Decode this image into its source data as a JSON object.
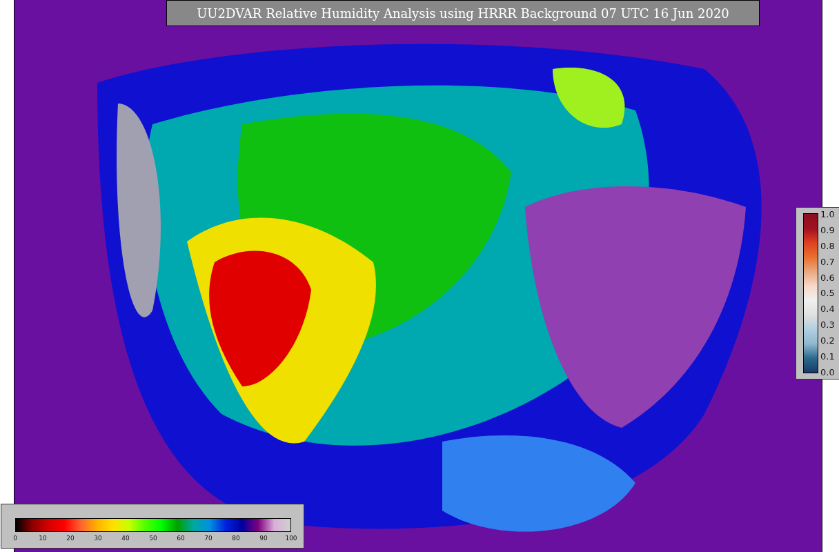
{
  "title": "UU2DVAR Relative Humidity Analysis using HRRR Background 07 UTC 16 Jun 2020",
  "humidity_colorbar": {
    "ticks": [
      "0",
      "10",
      "20",
      "30",
      "40",
      "50",
      "60",
      "70",
      "80",
      "90",
      "100"
    ]
  },
  "ratio_colorbar": {
    "ticks": [
      "1.0",
      "0.9",
      "0.8",
      "0.7",
      "0.6",
      "0.5",
      "0.4",
      "0.3",
      "0.2",
      "0.1",
      "0.0"
    ]
  }
}
